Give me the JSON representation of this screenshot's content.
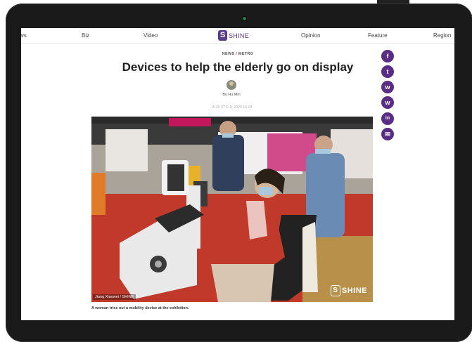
{
  "nav": {
    "items": [
      "ws",
      "Biz",
      "Video",
      "Opinion",
      "Feature",
      "Region"
    ],
    "logo_mark": "S",
    "logo_text": "SHINE"
  },
  "article": {
    "kicker_left": "NEWS",
    "kicker_sep": "/",
    "kicker_right": "METRO",
    "headline": "Devices to help the elderly go on display",
    "byline": "By Hu Min",
    "dateline": "15:28 UTC+8, 2020-10-28",
    "photo_credit": "Jiang Xiaowei / SHINE",
    "watermark": "SHINE",
    "caption": "A woman tries out a mobility device at the exhibition."
  },
  "share": [
    {
      "icon": "facebook-icon",
      "glyph": "f"
    },
    {
      "icon": "twitter-icon",
      "glyph": "t"
    },
    {
      "icon": "wechat-icon",
      "glyph": "w"
    },
    {
      "icon": "weibo-icon",
      "glyph": "w"
    },
    {
      "icon": "linkedin-icon",
      "glyph": "in"
    },
    {
      "icon": "email-icon",
      "glyph": "✉"
    }
  ],
  "colors": {
    "brand": "#5a2d84",
    "accent": "#c2185b",
    "device_bezel": "#1a1a1a"
  }
}
